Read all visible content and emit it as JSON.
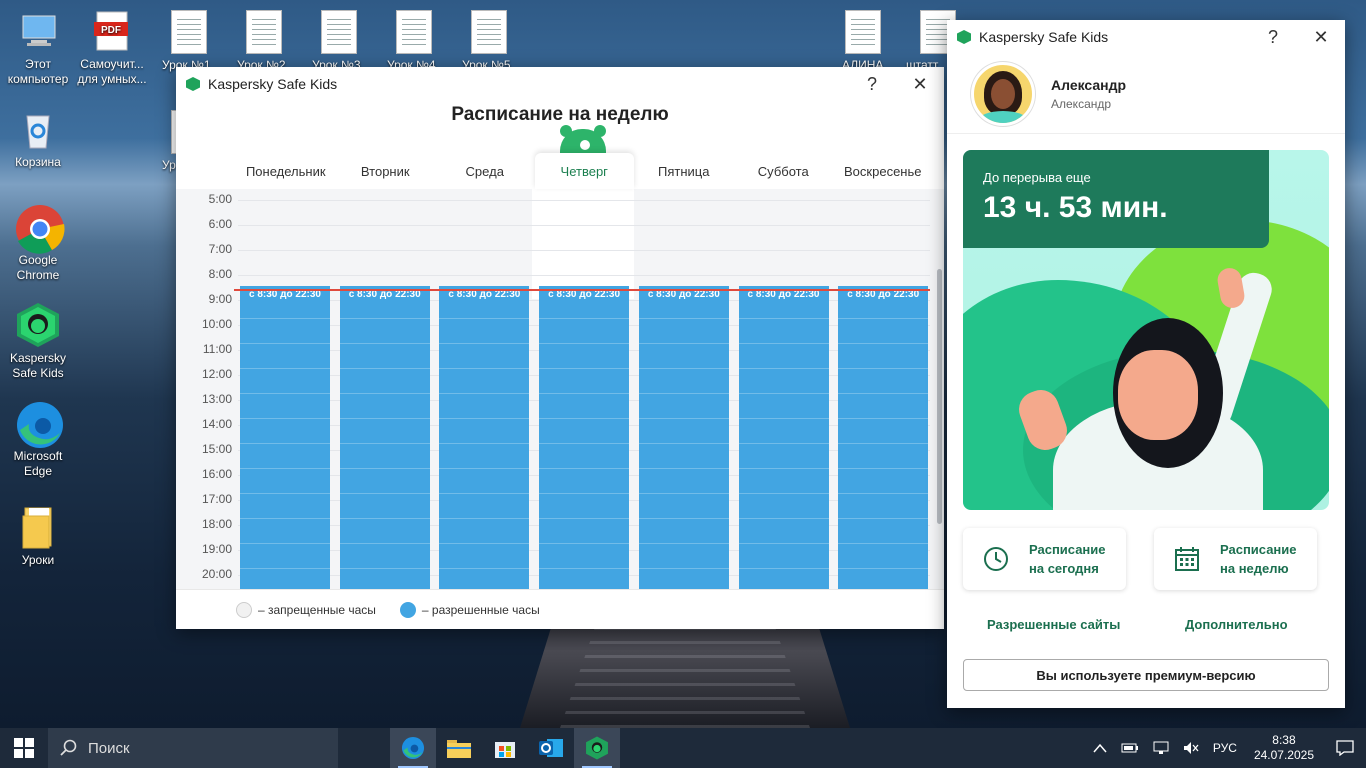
{
  "desktop": {
    "icons": [
      {
        "label": "Этот компьютер"
      },
      {
        "label": "Самоучит... для умных..."
      },
      {
        "label": "Корзина"
      },
      {
        "label": "Google Chrome"
      },
      {
        "label": "Kaspersky Safe Kids"
      },
      {
        "label": "Microsoft Edge"
      },
      {
        "label": "Уроки"
      }
    ],
    "top_docs": [
      "Урок №1",
      "Урок №2",
      "Урок №3",
      "Урок №4",
      "Урок №5",
      "АЛИНА",
      "штатт"
    ],
    "partial_doc": "Ур"
  },
  "schedule_window": {
    "app_title": "Kaspersky Safe Kids",
    "help": "?",
    "close": "✕",
    "heading": "Расписание на неделю",
    "days": [
      "Понедельник",
      "Вторник",
      "Среда",
      "Четверг",
      "Пятница",
      "Суббота",
      "Воскресенье"
    ],
    "active_day_index": 3,
    "hours": [
      "5:00",
      "6:00",
      "7:00",
      "8:00",
      "9:00",
      "10:00",
      "11:00",
      "12:00",
      "13:00",
      "14:00",
      "15:00",
      "16:00",
      "17:00",
      "18:00",
      "19:00",
      "20:00"
    ],
    "block_label": "с 8:30 до 22:30",
    "legend": {
      "forbidden": "– запрещенные часы",
      "allowed": "– разрешенные часы"
    },
    "colors": {
      "allowed": "#42a5e2",
      "forbidden": "#f4f5f7",
      "now_line": "#e04a3d"
    }
  },
  "main_window": {
    "app_title": "Kaspersky Safe Kids",
    "help": "?",
    "close": "✕",
    "profile": {
      "name": "Александр",
      "sub": "Александр"
    },
    "break": {
      "label": "До перерыва еще",
      "value": "13 ч. 53 мин."
    },
    "actions": {
      "today_line1": "Расписание",
      "today_line2": "на сегодня",
      "week_line1": "Расписание",
      "week_line2": "на неделю"
    },
    "links": {
      "sites": "Разрешенные сайты",
      "more": "Дополнительно"
    },
    "premium": "Вы используете премиум-версию",
    "colors": {
      "accent": "#1b6f4f",
      "badge": "#1e7a5b"
    }
  },
  "taskbar": {
    "search_placeholder": "Поиск",
    "lang": "РУС",
    "time": "8:38",
    "date": "24.07.2025"
  }
}
